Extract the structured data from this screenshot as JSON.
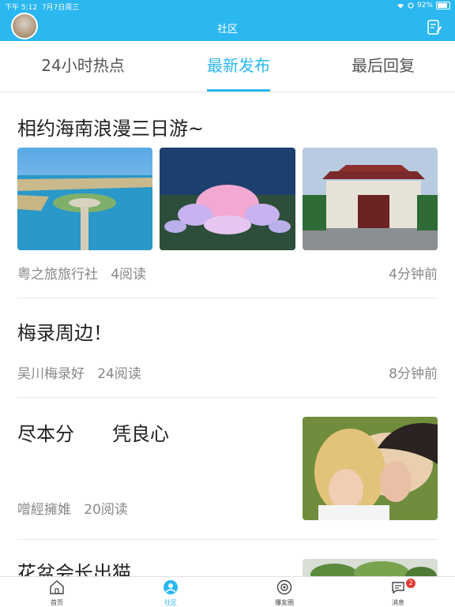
{
  "status_bar": {
    "time": "下午 5:12",
    "date": "7月7日周三",
    "battery": "92%"
  },
  "header": {
    "title": "社区"
  },
  "tabs": [
    {
      "label": "24小时热点"
    },
    {
      "label": "最新发布"
    },
    {
      "label": "最后回复"
    }
  ],
  "posts": [
    {
      "title": "相约海南浪漫三日游~",
      "author": "粤之旅旅行社",
      "reads": "4阅读",
      "time": "4分钟前"
    },
    {
      "title": "梅录周边！",
      "author": "吴川梅录好",
      "reads": "24阅读",
      "time": "8分钟前"
    },
    {
      "title": "尽本分　　凭良心",
      "author": "噌經擁婎",
      "reads": "20阅读",
      "time": ""
    },
    {
      "title": "花盆会长出猫",
      "author": "",
      "reads": "",
      "time": ""
    }
  ],
  "bottom_nav": [
    {
      "label": "首页"
    },
    {
      "label": "社区"
    },
    {
      "label": "爆友圈"
    },
    {
      "label": "消息",
      "badge": "2"
    }
  ],
  "colors": {
    "accent": "#2bb7f0",
    "badge": "#e53935"
  }
}
